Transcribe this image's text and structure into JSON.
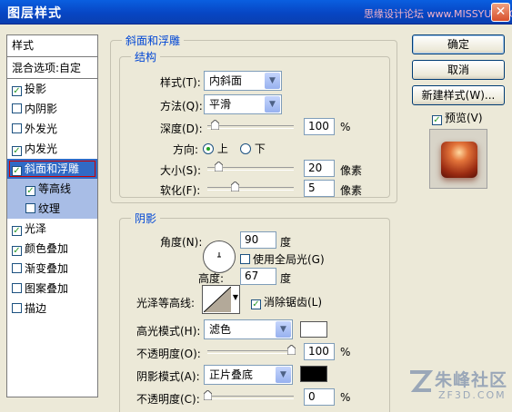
{
  "window": {
    "title": "图层样式",
    "watermark": "思缘设计论坛 www.MISSYUAN.COM",
    "close_glyph": "✕"
  },
  "sidebar": {
    "header": "样式",
    "blend_options": "混合选项:自定",
    "items": [
      {
        "label": "投影",
        "checked": true
      },
      {
        "label": "内阴影",
        "checked": false
      },
      {
        "label": "外发光",
        "checked": false
      },
      {
        "label": "内发光",
        "checked": true
      },
      {
        "label": "斜面和浮雕",
        "checked": true,
        "selected": true
      },
      {
        "label": "等高线",
        "checked": true,
        "sub": true
      },
      {
        "label": "纹理",
        "checked": false,
        "sub": true
      },
      {
        "label": "光泽",
        "checked": true
      },
      {
        "label": "颜色叠加",
        "checked": true
      },
      {
        "label": "渐变叠加",
        "checked": false
      },
      {
        "label": "图案叠加",
        "checked": false
      },
      {
        "label": "描边",
        "checked": false
      }
    ]
  },
  "bevel": {
    "group_title": "斜面和浮雕",
    "structure_title": "结构",
    "style_label": "样式(T):",
    "style_value": "内斜面",
    "technique_label": "方法(Q):",
    "technique_value": "平滑",
    "depth_label": "深度(D):",
    "depth_value": "100",
    "depth_unit": "%",
    "direction_label": "方向:",
    "dir_up": "上",
    "dir_down": "下",
    "direction_selected": "上",
    "size_label": "大小(S):",
    "size_value": "20",
    "size_unit": "像素",
    "soften_label": "软化(F):",
    "soften_value": "5",
    "soften_unit": "像素"
  },
  "shading": {
    "title": "阴影",
    "angle_label": "角度(N):",
    "angle_value": "90",
    "angle_unit": "度",
    "global_light_label": "使用全局光(G)",
    "global_light_checked": false,
    "altitude_label": "高度:",
    "altitude_value": "67",
    "altitude_unit": "度",
    "gloss_contour_label": "光泽等高线:",
    "antialias_label": "消除锯齿(L)",
    "antialias_checked": true,
    "highlight_mode_label": "高光模式(H):",
    "highlight_mode_value": "滤色",
    "highlight_color": "#ffffff",
    "highlight_opacity_label": "不透明度(O):",
    "highlight_opacity_value": "100",
    "highlight_opacity_unit": "%",
    "shadow_mode_label": "阴影模式(A):",
    "shadow_mode_value": "正片叠底",
    "shadow_color": "#000000",
    "shadow_opacity_label": "不透明度(C):",
    "shadow_opacity_value": "0",
    "shadow_opacity_unit": "%"
  },
  "buttons": {
    "ok": "确定",
    "cancel": "取消",
    "new_style": "新建样式(W)...",
    "preview_label": "预览(V)",
    "preview_checked": true
  },
  "brand": {
    "text": "朱峰社区",
    "sub": "ZF3D.COM"
  }
}
